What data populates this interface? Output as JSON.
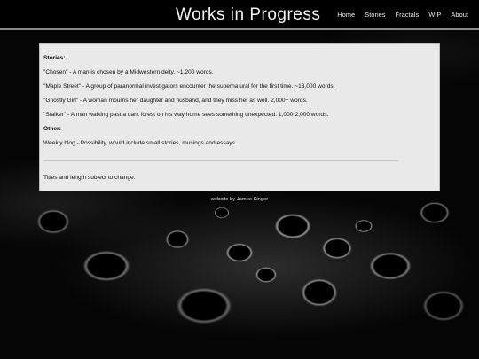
{
  "header": {
    "title": "Works in Progress",
    "nav": [
      "Home",
      "Stories",
      "Fractals",
      "WIP",
      "About"
    ]
  },
  "content": {
    "stories_heading": "Stories:",
    "stories": [
      "\"Chosen\" - A man is chosen by a Midwestern deity. ~1,200 words.",
      "\"Maple Street\" - A group of paranormal investigators encounter the supernatural for the first time. ~13,000 words.",
      "\"Ghostly Girl\" - A woman mourns her daughter and husband, and they miss her as well. 2,000+ words.",
      "\"Stalker\" - A man walking past a dark forest on his way home sees something unexpected. 1,000-2,000 words."
    ],
    "other_heading": "Other:",
    "other": "Weekly blog - Possibility, would include small stories, musings and essays.",
    "note": "Titles and length subject to change."
  },
  "footer": {
    "credit": "website by James Singer"
  },
  "colors": {
    "header_bg": "#000000",
    "header_border": "#8a8a8a",
    "card_bg": "#e9e9e9",
    "text": "#111111"
  }
}
